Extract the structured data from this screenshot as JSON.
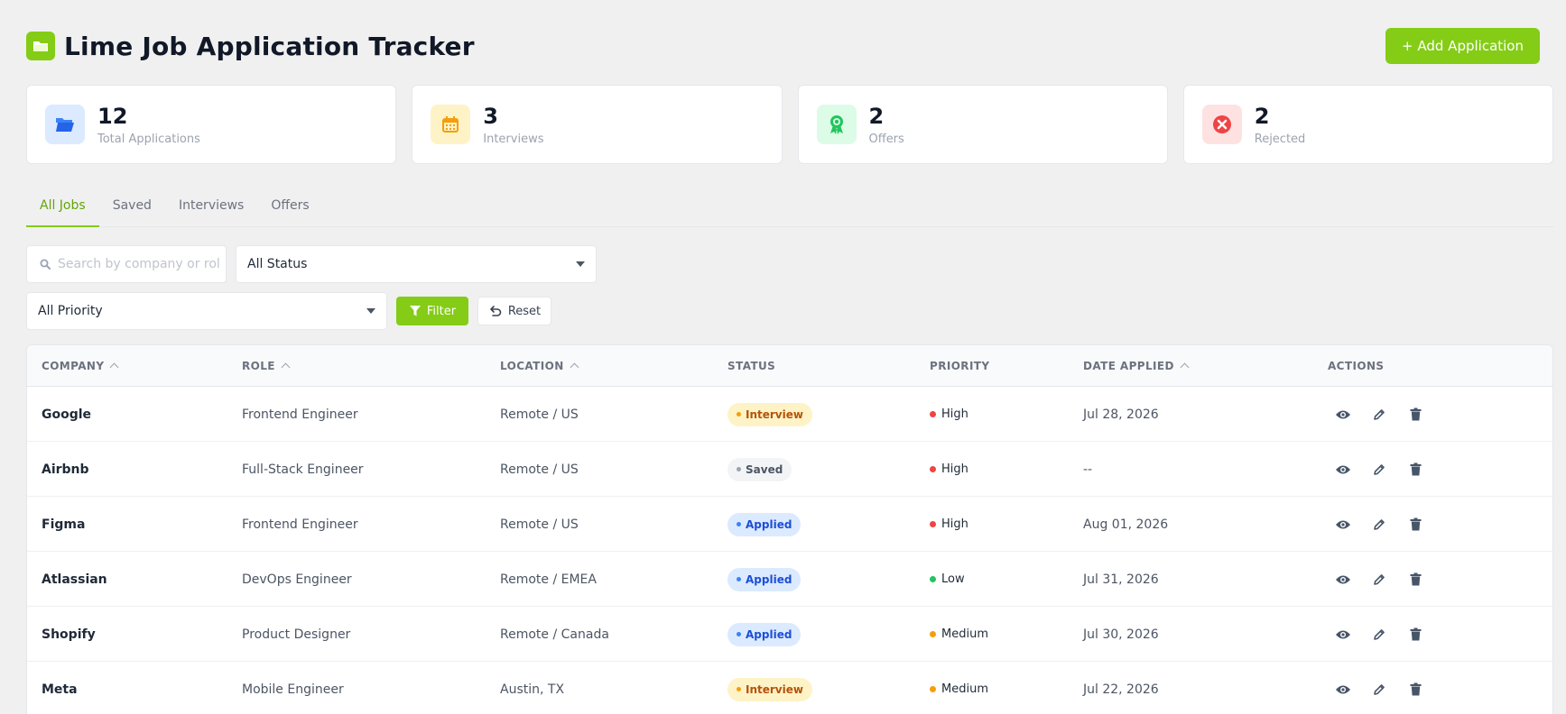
{
  "app": {
    "title": "Lime Job Application Tracker",
    "add_button": "+ Add Application",
    "accent_color": "#84cc16"
  },
  "stats": [
    {
      "value": "12",
      "label": "Total Applications",
      "icon": "folder-open-icon"
    },
    {
      "value": "3",
      "label": "Interviews",
      "icon": "calendar-icon"
    },
    {
      "value": "2",
      "label": "Offers",
      "icon": "award-icon"
    },
    {
      "value": "2",
      "label": "Rejected",
      "icon": "x-circle-icon"
    }
  ],
  "tabs": [
    {
      "label": "All Jobs",
      "active": true
    },
    {
      "label": "Saved",
      "active": false
    },
    {
      "label": "Interviews",
      "active": false
    },
    {
      "label": "Offers",
      "active": false
    }
  ],
  "filters": {
    "search_placeholder": "Search by company or role...",
    "search_value": "",
    "status_selected": "All Status",
    "priority_selected": "All Priority",
    "filter_button": "Filter",
    "reset_button": "Reset"
  },
  "table": {
    "headers": {
      "company": "COMPANY",
      "role": "ROLE",
      "location": "LOCATION",
      "status": "STATUS",
      "priority": "PRIORITY",
      "date": "DATE APPLIED",
      "actions": "ACTIONS"
    },
    "rows": [
      {
        "company": "Google",
        "role": "Frontend Engineer",
        "location": "Remote / US",
        "status": "Interview",
        "status_kind": "interview",
        "priority": "High",
        "priority_color": "#ef4444",
        "date": "Jul 28, 2026"
      },
      {
        "company": "Airbnb",
        "role": "Full-Stack Engineer",
        "location": "Remote / US",
        "status": "Saved",
        "status_kind": "saved",
        "priority": "High",
        "priority_color": "#ef4444",
        "date": "--"
      },
      {
        "company": "Figma",
        "role": "Frontend Engineer",
        "location": "Remote / US",
        "status": "Applied",
        "status_kind": "applied",
        "priority": "High",
        "priority_color": "#ef4444",
        "date": "Aug 01, 2026"
      },
      {
        "company": "Atlassian",
        "role": "DevOps Engineer",
        "location": "Remote / EMEA",
        "status": "Applied",
        "status_kind": "applied",
        "priority": "Low",
        "priority_color": "#22c55e",
        "date": "Jul 31, 2026"
      },
      {
        "company": "Shopify",
        "role": "Product Designer",
        "location": "Remote / Canada",
        "status": "Applied",
        "status_kind": "applied",
        "priority": "Medium",
        "priority_color": "#f59e0b",
        "date": "Jul 30, 2026"
      },
      {
        "company": "Meta",
        "role": "Mobile Engineer",
        "location": "Austin, TX",
        "status": "Interview",
        "status_kind": "interview",
        "priority": "Medium",
        "priority_color": "#f59e0b",
        "date": "Jul 22, 2026"
      }
    ]
  }
}
